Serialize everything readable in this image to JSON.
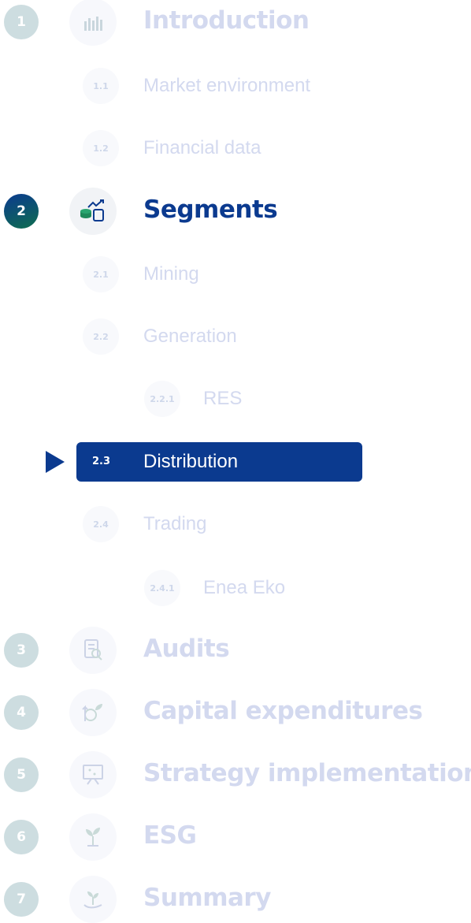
{
  "colors": {
    "active_blue": "#0b3a8f",
    "green_badge": "#0f6e4f",
    "faded_text": "#d3d9ef",
    "faded_badge": "#cddde0"
  },
  "sections": [
    {
      "num": "1",
      "title": "Introduction",
      "icon": "chart-growth-icon"
    },
    {
      "num": "2",
      "title": "Segments",
      "icon": "coins-growth-icon"
    },
    {
      "num": "3",
      "title": "Audits",
      "icon": "document-search-icon"
    },
    {
      "num": "4",
      "title": "Capital expenditures",
      "icon": "investment-plant-icon"
    },
    {
      "num": "5",
      "title": "Strategy implementation",
      "icon": "presentation-board-icon"
    },
    {
      "num": "6",
      "title": "ESG",
      "icon": "sprout-icon"
    },
    {
      "num": "7",
      "title": "Summary",
      "icon": "plant-hand-icon"
    }
  ],
  "subsections": {
    "s1_1": {
      "num": "1.1",
      "label": "Market environment"
    },
    "s1_2": {
      "num": "1.2",
      "label": "Financial data"
    },
    "s2_1": {
      "num": "2.1",
      "label": "Mining"
    },
    "s2_2": {
      "num": "2.2",
      "label": "Generation"
    },
    "s2_2_1": {
      "num": "2.2.1",
      "label": "RES"
    },
    "s2_3": {
      "num": "2.3",
      "label": "Distribution"
    },
    "s2_4": {
      "num": "2.4",
      "label": "Trading"
    },
    "s2_4_1": {
      "num": "2.4.1",
      "label": "Enea Eko"
    }
  }
}
